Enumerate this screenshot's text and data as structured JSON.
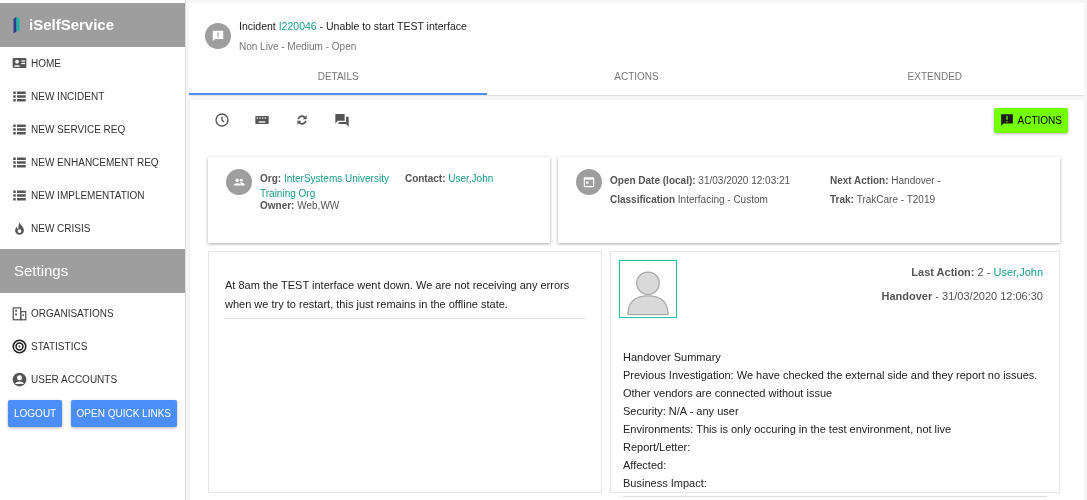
{
  "app": {
    "title": "iSelfService"
  },
  "sidebar": {
    "items": [
      {
        "label": "HOME"
      },
      {
        "label": "NEW INCIDENT"
      },
      {
        "label": "NEW SERVICE REQ"
      },
      {
        "label": "NEW ENHANCEMENT REQ"
      },
      {
        "label": "NEW IMPLEMENTATION"
      },
      {
        "label": "NEW CRISIS"
      }
    ],
    "settings_title": "Settings",
    "settings_items": [
      {
        "label": "ORGANISATIONS"
      },
      {
        "label": "STATISTICS"
      },
      {
        "label": "USER ACCOUNTS"
      }
    ],
    "buttons": [
      "LOGOUT",
      "OPEN QUICK LINKS"
    ]
  },
  "incident": {
    "prefix": "Incident ",
    "id": "I220046",
    "suffix": " - Unable to start TEST interface",
    "subtitle": "Non Live - Medium - Open"
  },
  "tabs": [
    {
      "label": "DETAILS",
      "selected": true
    },
    {
      "label": "ACTIONS",
      "selected": false
    },
    {
      "label": "EXTENDED",
      "selected": false
    }
  ],
  "toolbar": {
    "actions_button": "ACTIONS"
  },
  "org_card": {
    "lines": [
      [
        {
          "label": "Org:",
          "value": "InterSystems University",
          "link": true
        },
        {
          "label": "Contact:",
          "value": "User,John",
          "link": true
        }
      ],
      [
        {
          "value": "Training Org",
          "link": true
        }
      ],
      [
        {
          "label": "Owner:",
          "value": "Web,WW",
          "link": false
        }
      ]
    ]
  },
  "date_card": {
    "columns": [
      [
        {
          "label": "Open Date (local):",
          "value": "31/03/2020 12:03:21"
        },
        {
          "label": "Classification",
          "value": "Interfacing - Custom"
        }
      ],
      [
        {
          "label": "Next Action:",
          "value": "Handover -"
        },
        {
          "label": "Trak:",
          "value": "TrakCare - T2019"
        }
      ]
    ]
  },
  "description": "At 8am the TEST interface went down. We are not receiving any errors when we try to restart, this just remains in the offline state.",
  "last_action": {
    "label": "Last Action:",
    "number": "2 - ",
    "user": "User,John",
    "type": "Handover",
    "date": " - 31/03/2020 12:06:30"
  },
  "summary_lines": [
    "Handover Summary",
    "Previous Investigation: We have checked the external side and they report no issues.",
    "Other vendors are connected without issue",
    "Security: N/A - any user",
    "Environments: This is only occuring in the test environment, not live",
    "Report/Letter:",
    "Affected:",
    "Business Impact:"
  ]
}
